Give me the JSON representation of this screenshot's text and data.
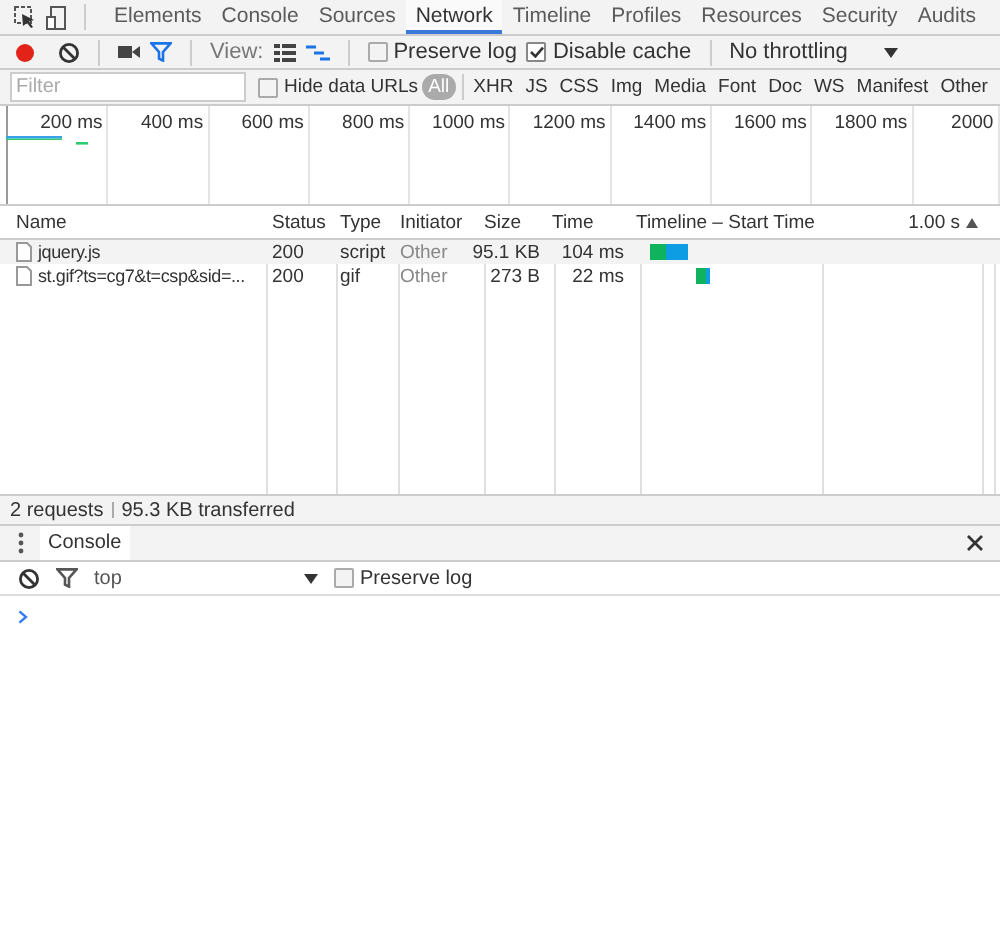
{
  "main_tabs": [
    {
      "label": "Elements",
      "selected": false
    },
    {
      "label": "Console",
      "selected": false
    },
    {
      "label": "Sources",
      "selected": false
    },
    {
      "label": "Network",
      "selected": true
    },
    {
      "label": "Timeline",
      "selected": false
    },
    {
      "label": "Profiles",
      "selected": false
    },
    {
      "label": "Resources",
      "selected": false
    },
    {
      "label": "Security",
      "selected": false
    },
    {
      "label": "Audits",
      "selected": false
    }
  ],
  "toolbar": {
    "recording": true,
    "view_label": "View:",
    "preserve_log": {
      "label": "Preserve log",
      "checked": false
    },
    "disable_cache": {
      "label": "Disable cache",
      "checked": true
    },
    "throttling": "No throttling"
  },
  "filter": {
    "placeholder": "Filter",
    "hide_data_urls": {
      "label": "Hide data URLs",
      "checked": false
    },
    "types": [
      {
        "label": "All",
        "selected": true
      },
      {
        "label": "XHR",
        "selected": false
      },
      {
        "label": "JS",
        "selected": false
      },
      {
        "label": "CSS",
        "selected": false
      },
      {
        "label": "Img",
        "selected": false
      },
      {
        "label": "Media",
        "selected": false
      },
      {
        "label": "Font",
        "selected": false
      },
      {
        "label": "Doc",
        "selected": false
      },
      {
        "label": "WS",
        "selected": false
      },
      {
        "label": "Manifest",
        "selected": false
      },
      {
        "label": "Other",
        "selected": false
      }
    ]
  },
  "overview": {
    "ticks": [
      "200 ms",
      "400 ms",
      "600 ms",
      "800 ms",
      "1000 ms",
      "1200 ms",
      "1400 ms",
      "1600 ms",
      "1800 ms",
      "2000"
    ]
  },
  "table": {
    "columns": [
      "Name",
      "Status",
      "Type",
      "Initiator",
      "Size",
      "Time",
      "Timeline – Start Time"
    ],
    "timeline_scale": "1.00 s",
    "rows": [
      {
        "name": "jquery.js",
        "status": "200",
        "type": "script",
        "initiator": "Other",
        "size": "95.1 KB",
        "time": "104 ms"
      },
      {
        "name": "st.gif?ts=cg7&t=csp&sid=...",
        "status": "200",
        "type": "gif",
        "initiator": "Other",
        "size": "273 B",
        "time": "22 ms"
      }
    ]
  },
  "status_bar": {
    "requests": "2 requests",
    "transferred": "95.3 KB transferred"
  },
  "drawer": {
    "tabs": [
      {
        "label": "Console",
        "selected": true
      }
    ],
    "context": "top",
    "preserve_log": {
      "label": "Preserve log",
      "checked": false
    }
  }
}
